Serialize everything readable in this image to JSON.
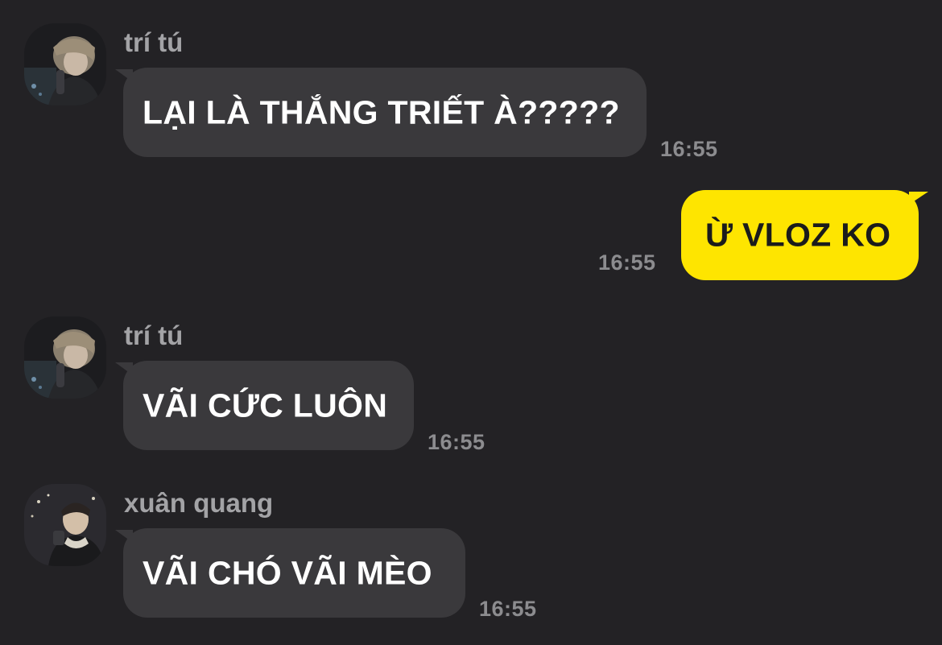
{
  "chat": {
    "messages": [
      {
        "sender": "trí tú",
        "avatar": "sender-photo-avatar",
        "text": "LẠI LÀ THẮNG TRIẾT À?????",
        "time": "16:55",
        "direction": "incoming"
      },
      {
        "text": "Ừ VLOZ KO",
        "time": "16:55",
        "direction": "outgoing"
      },
      {
        "sender": "trí tú",
        "avatar": "sender-photo-avatar",
        "text": "VÃI CỨC LUÔN",
        "time": "16:55",
        "direction": "incoming"
      },
      {
        "sender": "xuân quang",
        "avatar": "sender-photo-avatar",
        "text": "VÃI CHÓ VÃI MÈO",
        "time": "16:55",
        "direction": "incoming"
      }
    ]
  },
  "colors": {
    "background": "#232225",
    "incoming_bubble": "#3a393c",
    "outgoing_bubble": "#fee500",
    "sender_name": "#a3a3a6",
    "timestamp": "#8c8c8f"
  }
}
